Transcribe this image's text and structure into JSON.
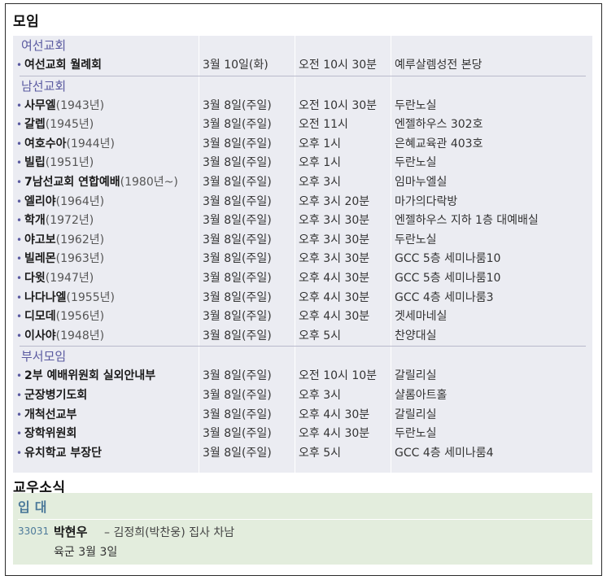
{
  "sections": {
    "meetings_title": "모임",
    "news_title": "교우소식"
  },
  "groups": [
    {
      "heading": "여선교회",
      "rows": [
        {
          "name": "여선교회 월례회",
          "year": "",
          "date": "3월 10일(화)",
          "time": "오전 10시 30분",
          "place": "예루살렘성전 본당"
        }
      ]
    },
    {
      "heading": "남선교회",
      "rows": [
        {
          "name": "사무엘",
          "year": "(1943년)",
          "date": "3월 8일(주일)",
          "time": "오전 10시 30분",
          "place": "두란노실"
        },
        {
          "name": "갈렙",
          "year": "(1945년)",
          "date": "3월 8일(주일)",
          "time": "오전 11시",
          "place": "엔젤하우스 302호"
        },
        {
          "name": "여호수아",
          "year": "(1944년)",
          "date": "3월 8일(주일)",
          "time": "오후 1시",
          "place": "은혜교육관 403호"
        },
        {
          "name": "빌립",
          "year": "(1951년)",
          "date": "3월 8일(주일)",
          "time": "오후 1시",
          "place": "두란노실"
        },
        {
          "name": "7남선교회 연합예배",
          "year": "(1980년~)",
          "date": "3월 8일(주일)",
          "time": "오후 3시",
          "place": "임마누엘실"
        },
        {
          "name": "엘리야",
          "year": "(1964년)",
          "date": "3월 8일(주일)",
          "time": "오후 3시 20분",
          "place": "마가의다락방"
        },
        {
          "name": "학개",
          "year": "(1972년)",
          "date": "3월 8일(주일)",
          "time": "오후 3시 30분",
          "place": "엔젤하우스 지하 1층 대예배실"
        },
        {
          "name": "야고보",
          "year": "(1962년)",
          "date": "3월 8일(주일)",
          "time": "오후 3시 30분",
          "place": "두란노실"
        },
        {
          "name": "빌레몬",
          "year": "(1963년)",
          "date": "3월 8일(주일)",
          "time": "오후 3시 30분",
          "place": "GCC 5층 세미나룸10"
        },
        {
          "name": "다윗",
          "year": "(1947년)",
          "date": "3월 8일(주일)",
          "time": "오후 4시 30분",
          "place": "GCC 5층 세미나룸10"
        },
        {
          "name": "나다나엘",
          "year": "(1955년)",
          "date": "3월 8일(주일)",
          "time": "오후 4시 30분",
          "place": "GCC 4층 세미나룸3"
        },
        {
          "name": "디모데",
          "year": "(1956년)",
          "date": "3월 8일(주일)",
          "time": "오후 4시 30분",
          "place": "겟세마네실"
        },
        {
          "name": "이사야",
          "year": "(1948년)",
          "date": "3월 8일(주일)",
          "time": "오후 5시",
          "place": "찬양대실"
        }
      ]
    },
    {
      "heading": "부서모임",
      "rows": [
        {
          "name": "2부 예배위원회 실외안내부",
          "year": "",
          "date": "3월 8일(주일)",
          "time": "오전 10시 10분",
          "place": "갈릴리실"
        },
        {
          "name": "군장병기도회",
          "year": "",
          "date": "3월 8일(주일)",
          "time": "오후 3시",
          "place": "샬롬아트홀"
        },
        {
          "name": "개척선교부",
          "year": "",
          "date": "3월 8일(주일)",
          "time": "오후 4시 30분",
          "place": "갈릴리실"
        },
        {
          "name": "장학위원회",
          "year": "",
          "date": "3월 8일(주일)",
          "time": "오후 4시 30분",
          "place": "두란노실"
        },
        {
          "name": "유치학교 부장단",
          "year": "",
          "date": "3월 8일(주일)",
          "time": "오후 5시",
          "place": "GCC 4층 세미나룸4"
        }
      ]
    }
  ],
  "news": {
    "subheading": "입대",
    "entry": {
      "number": "33031",
      "name": "박현우",
      "description": "– 김정희(박찬웅) 집사 차남",
      "detail": "육군 3월 3일"
    }
  }
}
